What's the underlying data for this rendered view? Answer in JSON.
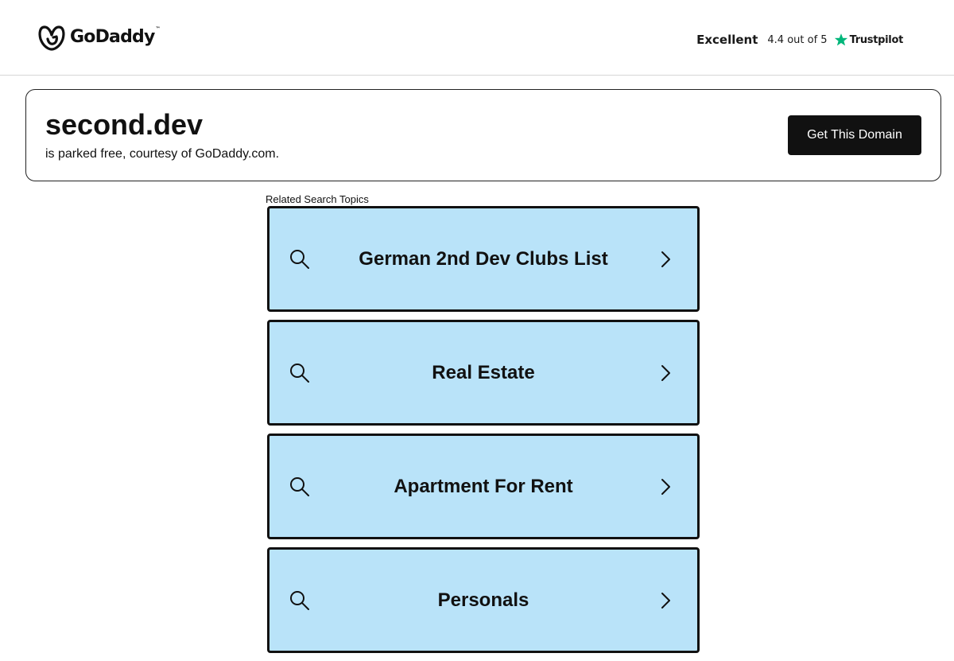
{
  "header": {
    "logo": {
      "text": "GoDaddy",
      "icon": "godaddy-logo-icon"
    },
    "trustpilot": {
      "rating_label": "Excellent",
      "score": "4.4 out of 5",
      "brand": "Trustpilot",
      "star_icon": "star-icon",
      "star_color": "#00b67a"
    }
  },
  "domain_card": {
    "domain": "second.dev",
    "subtitle": "is parked free, courtesy of GoDaddy.com.",
    "cta_label": "Get This Domain"
  },
  "related": {
    "heading": "Related Search Topics",
    "topics": [
      {
        "label": "German 2nd Dev Clubs List",
        "icon": "search-icon",
        "arrow": "chevron-right-icon"
      },
      {
        "label": "Real Estate",
        "icon": "search-icon",
        "arrow": "chevron-right-icon"
      },
      {
        "label": "Apartment For Rent",
        "icon": "search-icon",
        "arrow": "chevron-right-icon"
      },
      {
        "label": "Personals",
        "icon": "search-icon",
        "arrow": "chevron-right-icon"
      }
    ]
  },
  "colors": {
    "topic_background": "#b9e3f9",
    "topic_border": "#111111",
    "button_background": "#111111",
    "button_text": "#ffffff"
  }
}
